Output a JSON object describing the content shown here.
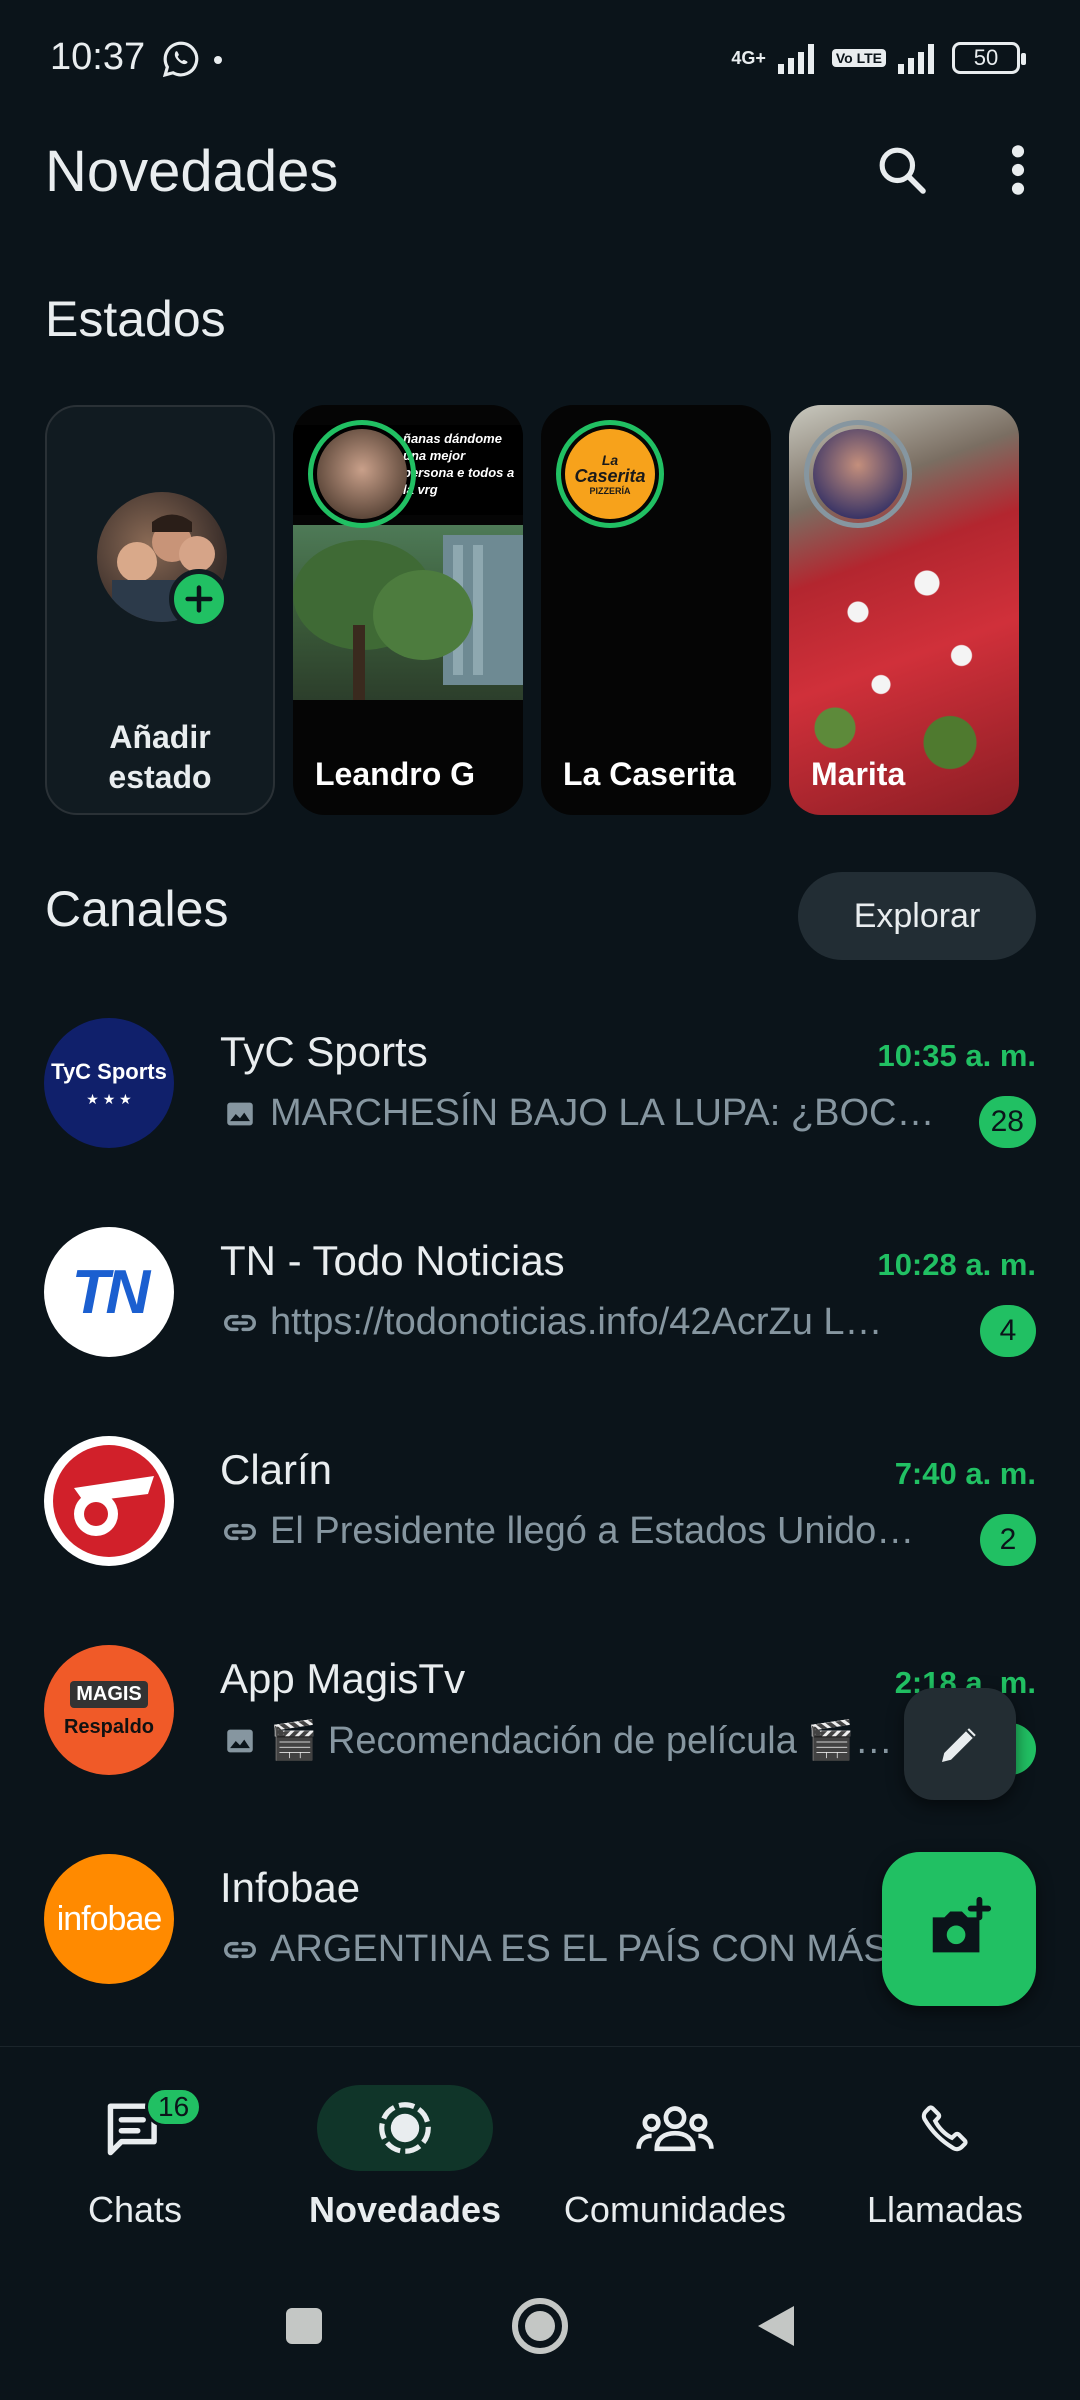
{
  "status_bar": {
    "time": "10:37",
    "network": "4G+",
    "volte": "Vo LTE",
    "battery": "50"
  },
  "header": {
    "title": "Novedades",
    "search_icon": "search-icon",
    "menu_icon": "more-vertical-icon"
  },
  "estados": {
    "title": "Estados",
    "cards": [
      {
        "label": "Añadir estado",
        "type": "add"
      },
      {
        "label": "Leandro G",
        "preview_text": "ñanas dándome una mejor persona e todos a la vrg"
      },
      {
        "label": "La Caserita",
        "logo_line1": "La",
        "logo_line2": "Caserita",
        "logo_line3": "PIZZERÍA"
      },
      {
        "label": "Marita"
      }
    ]
  },
  "canales": {
    "title": "Canales",
    "explore_label": "Explorar",
    "channels": [
      {
        "name": "TyC Sports",
        "logo_text": "TyC Sports",
        "logo_stars": "★ ★ ★",
        "time": "10:35 a. m.",
        "message": "MARCHESÍN BAJO LA LUPA: ¿BOC…",
        "msg_icon": "image-icon",
        "badge": "28",
        "logo_bg": "#10206b"
      },
      {
        "name": "TN - Todo Noticias",
        "logo_text": "TN",
        "time": "10:28 a. m.",
        "message": "https://todonoticias.info/42AcrZu L…",
        "msg_icon": "link-icon",
        "badge": "4",
        "logo_bg": "#ffffff"
      },
      {
        "name": "Clarín",
        "time": "7:40 a. m.",
        "message": "El Presidente llegó a Estados Unido…",
        "msg_icon": "link-icon",
        "badge": "2",
        "logo_bg": "#ffffff"
      },
      {
        "name": "App MagisTv",
        "logo_text": "MAGIS",
        "logo_sub": "Respaldo",
        "time": "2:18 a. m.",
        "message": "🎬 Recomendación de película 🎬…",
        "msg_icon": "image-icon",
        "badge": "5",
        "logo_bg": "#f05a28"
      },
      {
        "name": "Infobae",
        "logo_text": "infobae",
        "time": "",
        "message": "ARGENTINA ES EL PAÍS CON MÁS",
        "msg_icon": "link-icon",
        "badge": "",
        "logo_bg": "#ff8a00"
      }
    ]
  },
  "fabs": {
    "edit_icon": "pencil-icon",
    "camera_icon": "camera-plus-icon"
  },
  "bottom_nav": {
    "items": [
      {
        "label": "Chats",
        "icon": "chats-icon",
        "badge": "16",
        "active": false
      },
      {
        "label": "Novedades",
        "icon": "updates-icon",
        "active": true
      },
      {
        "label": "Comunidades",
        "icon": "communities-icon",
        "active": false
      },
      {
        "label": "Llamadas",
        "icon": "phone-icon",
        "active": false
      }
    ]
  },
  "colors": {
    "background": "#0b141a",
    "accent": "#21c063",
    "muted_text": "#8696a0"
  }
}
